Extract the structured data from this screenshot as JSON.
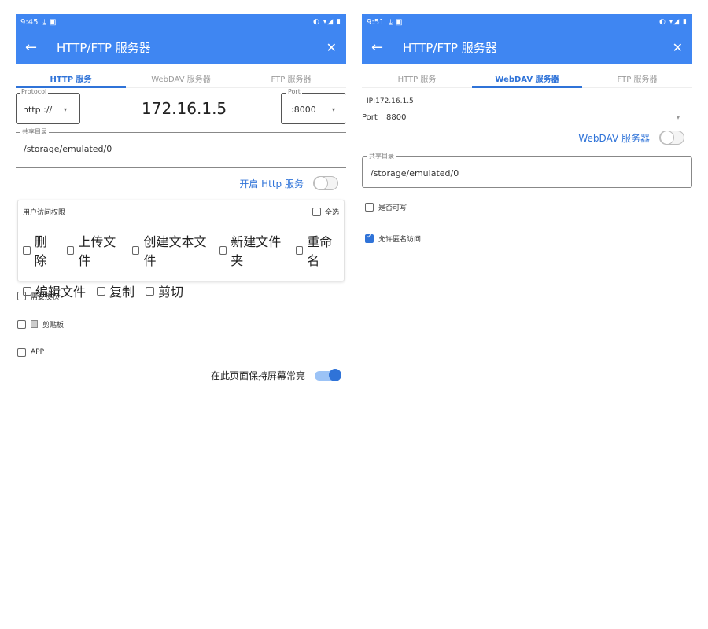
{
  "left": {
    "statusbar": {
      "time": "9:45",
      "icons_left": "⤓ ▣",
      "icons_right": "◐ ▾◢ ▮"
    },
    "appbar": {
      "back_icon": "←",
      "title": "HTTP/FTP 服务器",
      "close_icon": "✕"
    },
    "tabs": [
      "HTTP 服务",
      "WebDAV 服务器",
      "FTP 服务器"
    ],
    "active_tab": 0,
    "protocol": {
      "legend": "Protocol",
      "value": "http ://",
      "caret": "▾"
    },
    "ip": "172.16.1.5",
    "port": {
      "legend": "Port",
      "value": ":8000",
      "caret": "▾"
    },
    "share": {
      "legend": "共享目录",
      "path": "/storage/emulated/0"
    },
    "http_toggle_label": "开启 Http 服务",
    "permissions": {
      "title": "用户访问权限",
      "select_all": "全选",
      "row1": [
        "删除",
        "上传文件",
        "创建文本文件",
        "新建文件夹",
        "重命名"
      ],
      "row2": [
        "编辑文件",
        "复制",
        "剪切"
      ]
    },
    "options": [
      "需要授权",
      "剪贴板",
      "APP"
    ],
    "keep_screen_label": "在此页面保持屏幕常亮"
  },
  "right": {
    "statusbar": {
      "time": "9:51",
      "icons_left": "⤓ ▣",
      "icons_right": "◐ ▾◢ ▮"
    },
    "appbar": {
      "back_icon": "←",
      "title": "HTTP/FTP 服务器",
      "close_icon": "✕"
    },
    "tabs": [
      "HTTP 服务",
      "WebDAV 服务器",
      "FTP 服务器"
    ],
    "active_tab": 1,
    "ip_text": "IP:172.16.1.5",
    "port_label": "Port",
    "port_value": "8800",
    "port_caret": "▾",
    "webdav_toggle_label": "WebDAV 服务器",
    "share": {
      "legend": "共享目录",
      "path": "/storage/emulated/0"
    },
    "writable_label": "是否可写",
    "anonymous_label": "允许匿名访问"
  },
  "colors": {
    "primary": "#3f86f2",
    "accent": "#2f73d8"
  }
}
